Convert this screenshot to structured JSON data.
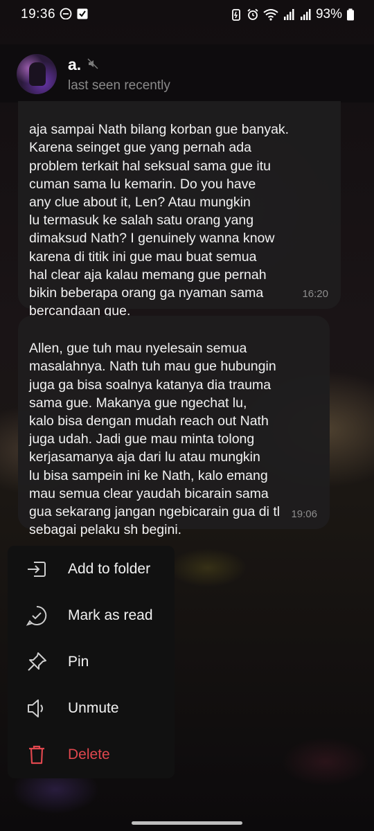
{
  "status_bar": {
    "time": "19:36",
    "battery": "93%"
  },
  "header": {
    "contact_name": "a.",
    "status": "last seen recently"
  },
  "messages": [
    {
      "text": "aja sampai Nath bilang korban gue banyak.\nKarena seinget gue yang pernah ada\nproblem terkait hal seksual sama gue itu\ncuman sama lu kemarin. Do you have\nany clue about it, Len? Atau mungkin\nlu termasuk ke salah satu orang yang\ndimaksud Nath? I genuinely wanna know\nkarena di titik ini gue mau buat semua\nhal clear aja kalau memang gue pernah\nbikin beberapa orang ga nyaman sama\nbercandaan gue.",
      "time": "16:20"
    },
    {
      "text": "Allen, gue tuh mau nyelesain semua\nmasalahnya. Nath tuh mau gue hubungin\njuga ga bisa soalnya katanya dia trauma\nsama gue. Makanya gue ngechat lu,\nkalo bisa dengan mudah reach out Nath\njuga udah. Jadi gue mau minta tolong\nkerjasamanya aja dari lu atau mungkin\nlu bisa sampein ini ke Nath, kalo emang\nmau semua clear yaudah bicarain sama\ngua sekarang jangan ngebicarain gua di tl\nsebagai pelaku sh begini.",
      "time": "19:06"
    }
  ],
  "menu": {
    "items": [
      {
        "label": "Add to folder",
        "icon": "folder-add-icon"
      },
      {
        "label": "Mark as read",
        "icon": "check-circle-icon"
      },
      {
        "label": "Pin",
        "icon": "pin-icon"
      },
      {
        "label": "Unmute",
        "icon": "speaker-icon"
      },
      {
        "label": "Delete",
        "icon": "trash-icon",
        "color": "#e0474e"
      }
    ]
  },
  "colors": {
    "bubble": "#1e1d1e",
    "danger": "#e0474e",
    "menu_bg": "#121212"
  }
}
